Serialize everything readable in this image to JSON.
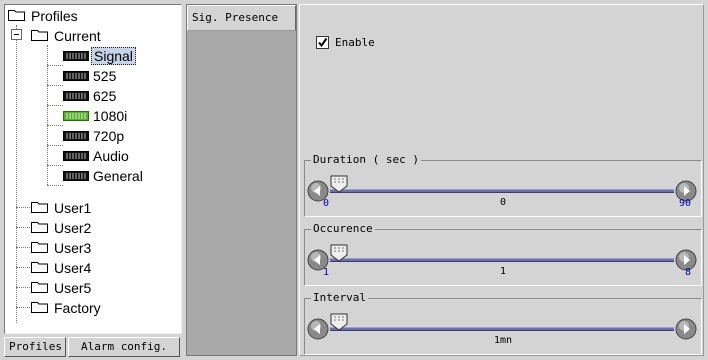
{
  "tree": {
    "root": "Profiles",
    "current": "Current",
    "children": [
      "Signal",
      "525",
      "625",
      "1080i",
      "720p",
      "Audio",
      "General"
    ],
    "others": [
      "User1",
      "User2",
      "User3",
      "User4",
      "User5",
      "Factory"
    ],
    "selected": "Signal",
    "highlight_chip": "1080i"
  },
  "bottom_tabs": {
    "profiles": "Profiles",
    "alarm": "Alarm config."
  },
  "category": {
    "tab": "Sig. Presence"
  },
  "settings": {
    "enable_label": "Enable",
    "enable_checked": true,
    "sliders": [
      {
        "title": "Duration ( sec )",
        "min": "0",
        "max": "90",
        "value": "0",
        "fraction": 0
      },
      {
        "title": "Occurence",
        "min": "1",
        "max": "8",
        "value": "1",
        "fraction": 0
      },
      {
        "title": "Interval",
        "min": "",
        "max": "",
        "value": "1mn",
        "fraction": 0
      }
    ]
  },
  "colors": {
    "track": "#6e6ea8",
    "limit_text": "#0000c8",
    "category_bg": "#a9a9a9",
    "chip_green": "#58b030"
  }
}
